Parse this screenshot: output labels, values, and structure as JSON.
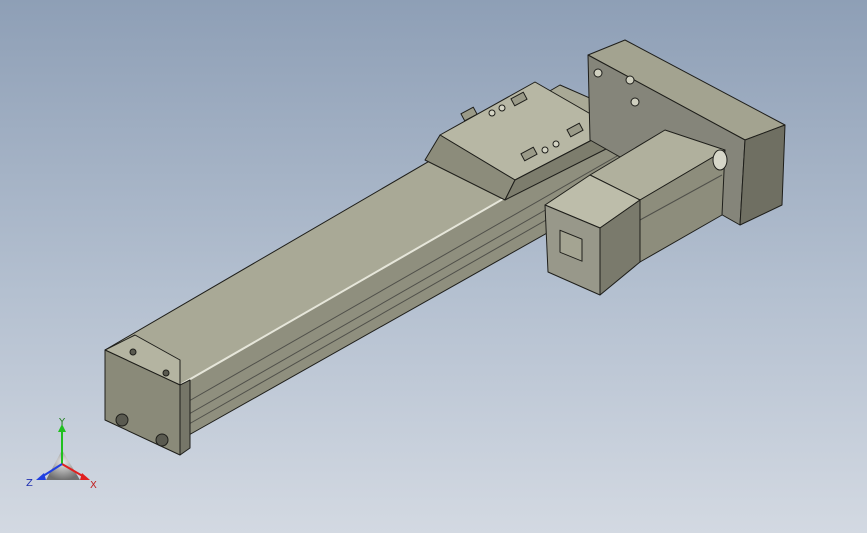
{
  "viewport": {
    "colors": {
      "background_top": "#8e9fb6",
      "background_bottom": "#d3d9e2",
      "part_face_light": "#b9b9a6",
      "part_face_mid": "#9a9a88",
      "part_face_dark": "#6f6f62",
      "edge": "#1e1e1a"
    }
  },
  "triad": {
    "x_label": "X",
    "y_label": "Y",
    "z_label": "Z",
    "x_color": "#e02020",
    "y_color": "#20c020",
    "z_color": "#2040e0"
  }
}
